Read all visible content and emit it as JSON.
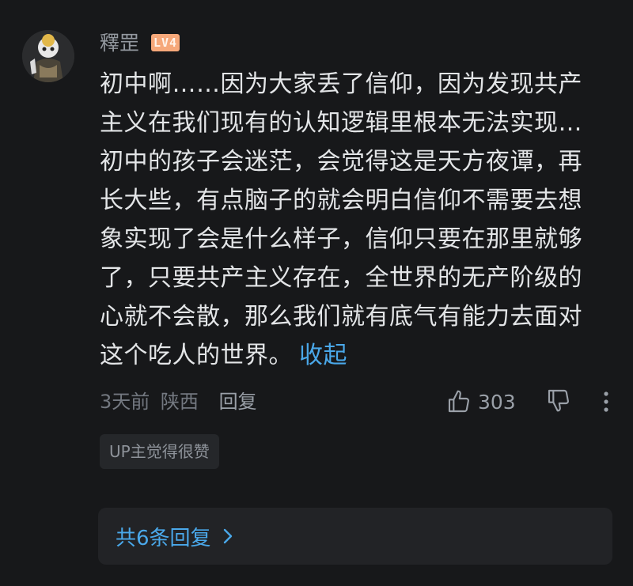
{
  "comment": {
    "username": "釋罡",
    "level": "LV4",
    "text": "初中啊……因为大家丢了信仰，因为发现共产主义在我们现有的认知逻辑里根本无法实现…初中的孩子会迷茫，会觉得这是天方夜谭，再长大些，有点脑子的就会明白信仰不需要去想象实现了会是什么样子，信仰只要在那里就够了，只要共产主义存在，全世界的无产阶级的心就不会散，那么我们就有底气有能力去面对这个吃人的世界。",
    "collapse_label": "收起",
    "time": "3天前",
    "location": "陕西",
    "reply_label": "回复",
    "like_count": "303",
    "up_badge": "UP主觉得很赞",
    "replies_label": "共6条回复"
  },
  "colors": {
    "background": "#17181a",
    "link": "#4aa8ea",
    "level_badge": "#f6a87a"
  },
  "icons": {
    "like": "thumbs-up-icon",
    "dislike": "thumbs-down-icon",
    "more": "more-vertical-icon",
    "chevron": "chevron-right-icon"
  }
}
